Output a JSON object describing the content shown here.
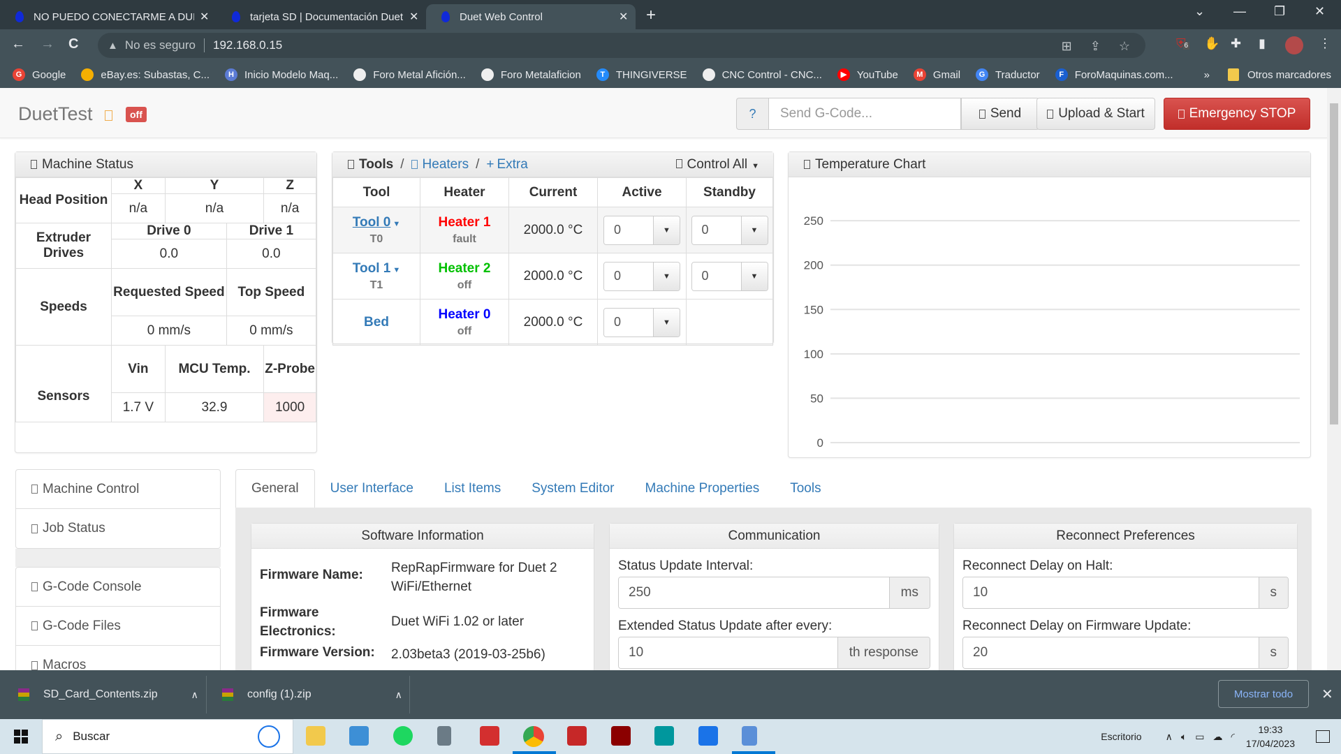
{
  "browser": {
    "tabs": [
      {
        "title": "NO PUEDO CONECTARME A DUE",
        "active": false
      },
      {
        "title": "tarjeta SD | Documentación Duet",
        "active": false
      },
      {
        "title": "Duet Web Control",
        "active": true
      }
    ],
    "new_tab": "+",
    "window_controls": {
      "dropdown": "⌄",
      "minimize": "—",
      "restore": "❐",
      "close": "✕"
    },
    "nav": {
      "back": "←",
      "forward": "→",
      "reload": "C"
    },
    "address": {
      "security_icon": "▲",
      "security_label": "No es seguro",
      "url": "192.168.0.15"
    },
    "omnibox_icons": [
      "translate-icon",
      "share-icon",
      "star-icon"
    ],
    "extensions": {
      "ublock_badge": "6"
    },
    "bookmarks": [
      {
        "label": "Google",
        "color": "#ea4335",
        "glyph": "G"
      },
      {
        "label": "eBay.es: Subastas, C...",
        "color": "#f5af02",
        "glyph": ""
      },
      {
        "label": "Inicio Modelo Maq...",
        "color": "#5b7bd5",
        "glyph": "H"
      },
      {
        "label": "Foro Metal Afición...",
        "color": "#eeeeee",
        "glyph": ""
      },
      {
        "label": "Foro Metalaficion",
        "color": "#eeeeee",
        "glyph": ""
      },
      {
        "label": "THINGIVERSE",
        "color": "#248bfb",
        "glyph": "T"
      },
      {
        "label": "CNC Control - CNC...",
        "color": "#eeeeee",
        "glyph": ""
      },
      {
        "label": "YouTube",
        "color": "#ff0000",
        "glyph": "▶"
      },
      {
        "label": "Gmail",
        "color": "#ea4335",
        "glyph": "M"
      },
      {
        "label": "Traductor",
        "color": "#4285f4",
        "glyph": "G"
      },
      {
        "label": "ForoMaquinas.com...",
        "color": "#1a5fd0",
        "glyph": "F"
      }
    ],
    "bookmarks_more": "»",
    "other_bookmarks": "Otros marcadores"
  },
  "app": {
    "brand": "DuetTest",
    "status_badge": "off",
    "gcode": {
      "help": "?",
      "placeholder": "Send G-Code...",
      "send": "Send"
    },
    "upload_start": "Upload & Start",
    "emergency_stop": "Emergency STOP"
  },
  "machine_status": {
    "title": "Machine Status",
    "head_position": {
      "label": "Head Position",
      "axes": [
        "X",
        "Y",
        "Z"
      ],
      "values": [
        "n/a",
        "n/a",
        "n/a"
      ]
    },
    "extruder_drives": {
      "label": "Extruder Drives",
      "drives": [
        "Drive 0",
        "Drive 1"
      ],
      "values": [
        "0.0",
        "0.0"
      ]
    },
    "speeds": {
      "label": "Speeds",
      "headers": [
        "Requested Speed",
        "Top Speed"
      ],
      "values": [
        "0 mm/s",
        "0 mm/s"
      ]
    },
    "sensors": {
      "label": "Sensors",
      "headers": [
        "Vin",
        "MCU Temp.",
        "Z-Probe"
      ],
      "values": [
        "1.7 V",
        "32.9",
        "1000"
      ]
    }
  },
  "tools_panel": {
    "title": "Tools",
    "sep": "/",
    "heaters_link": "Heaters",
    "extra_link": "Extra",
    "extra_prefix": "+",
    "control_all": "Control All",
    "columns": [
      "Tool",
      "Heater",
      "Current",
      "Active",
      "Standby"
    ],
    "rows": [
      {
        "tool": "Tool 0",
        "tool_sub": "T0",
        "heater": "Heater 1",
        "heater_color": "#ff0000",
        "heater_state": "fault",
        "current": "2000.0 °C",
        "active": "0",
        "standby": "0"
      },
      {
        "tool": "Tool 1",
        "tool_sub": "T1",
        "heater": "Heater 2",
        "heater_color": "#00c000",
        "heater_state": "off",
        "current": "2000.0 °C",
        "active": "0",
        "standby": "0"
      },
      {
        "tool": "Bed",
        "tool_sub": "",
        "heater": "Heater 0",
        "heater_color": "#0000ff",
        "heater_state": "off",
        "current": "2000.0 °C",
        "active": "0",
        "standby": null
      }
    ]
  },
  "chart_data": {
    "type": "line",
    "title": "Temperature Chart",
    "xlabel": "",
    "ylabel": "",
    "y_ticks": [
      0,
      50,
      100,
      150,
      200,
      250
    ],
    "ylim": [
      0,
      280
    ],
    "grid": true,
    "series": []
  },
  "sidebar": {
    "group1": [
      "Machine Control",
      "Job Status"
    ],
    "group2": [
      "G-Code Console",
      "G-Code Files",
      "Macros"
    ]
  },
  "settings": {
    "tabs": [
      "General",
      "User Interface",
      "List Items",
      "System Editor",
      "Machine Properties",
      "Tools"
    ],
    "active_tab": 0,
    "software": {
      "title": "Software Information",
      "rows": [
        {
          "k": "Firmware Name:",
          "v": "RepRapFirmware for Duet 2 WiFi/Ethernet"
        },
        {
          "k": "Firmware Electronics:",
          "v": "Duet WiFi 1.02 or later"
        },
        {
          "k": "Firmware Version:",
          "v": "2.03beta3 (2019-03-25b6)"
        }
      ]
    },
    "communication": {
      "title": "Communication",
      "status_interval_label": "Status Update Interval:",
      "status_interval_value": "250",
      "status_interval_unit": "ms",
      "extended_label": "Extended Status Update after every:",
      "extended_value": "10",
      "extended_unit": "th response"
    },
    "reconnect": {
      "title": "Reconnect Preferences",
      "halt_label": "Reconnect Delay on Halt:",
      "halt_value": "10",
      "halt_unit": "s",
      "fw_label": "Reconnect Delay on Firmware Update:",
      "fw_value": "20",
      "fw_unit": "s"
    }
  },
  "downloads": {
    "items": [
      "SD_Card_Contents.zip",
      "config (1).zip"
    ],
    "show_all": "Mostrar todo",
    "close": "✕"
  },
  "taskbar": {
    "search_placeholder": "Buscar",
    "desktop_label": "Escritorio",
    "time": "19:33",
    "date": "17/04/2023"
  }
}
